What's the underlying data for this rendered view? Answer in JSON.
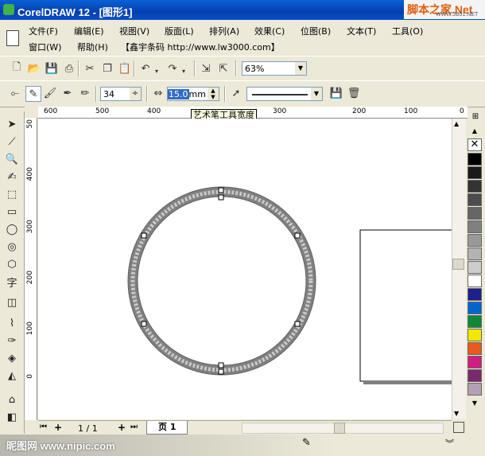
{
  "window": {
    "title": "CorelDRAW 12 - [图形1]"
  },
  "watermark_top": {
    "text": "脚本之家.Net",
    "sub": "WWW.JB51.NET"
  },
  "menu": {
    "row1": [
      "文件(F)",
      "编辑(E)",
      "视图(V)",
      "版面(L)",
      "排列(A)",
      "效果(C)",
      "位图(B)",
      "文本(T)",
      "工具(O)"
    ],
    "row2": [
      "窗口(W)",
      "帮助(H)",
      "【鑫宇条码 http://www.lw3000.com】"
    ]
  },
  "toolbar": {
    "zoom": "63%"
  },
  "property_bar": {
    "smoothing": "34",
    "width_value": "15.0",
    "width_unit": "mm",
    "tooltip": "艺术笔工具宽度"
  },
  "rulers": {
    "h": [
      "600",
      "500",
      "400",
      "300",
      "200",
      "100",
      "0"
    ],
    "v_top": "50",
    "v": [
      "400",
      "300",
      "200",
      "100",
      "0"
    ]
  },
  "page_nav": {
    "page_count": "1 / 1",
    "page_tab": "页 1"
  },
  "palette": [
    "#000000",
    "#1a1a1a",
    "#333333",
    "#4d4d4d",
    "#666666",
    "#808080",
    "#999999",
    "#b3b3b3",
    "#cccccc",
    "#ffffff",
    "#1e1e8c",
    "#0066cc",
    "#0c8a3a",
    "#f2e800",
    "#e85a1e",
    "#d21e82",
    "#7a2a6a",
    "#b4a0b4"
  ],
  "watermark_bottom": {
    "text": "昵图网 www.nipic.com"
  }
}
